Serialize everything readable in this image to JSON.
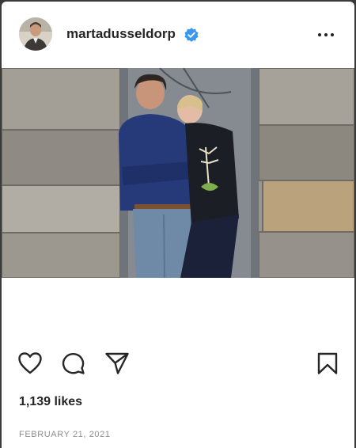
{
  "post": {
    "username": "martadusseldorp",
    "verified": true,
    "likes_text": "1,139 likes",
    "date_text": "FEBRUARY 21, 2021"
  },
  "icons": {
    "avatar": "profile-photo",
    "verified": "verified-badge-icon",
    "more": "more-options-icon",
    "like": "heart-icon",
    "comment": "comment-icon",
    "share": "paper-plane-icon",
    "save": "bookmark-icon"
  },
  "colors": {
    "text": "#262626",
    "muted": "#8e8e8e",
    "verified_blue": "#3897f0",
    "page_bg": "#ffffff"
  }
}
